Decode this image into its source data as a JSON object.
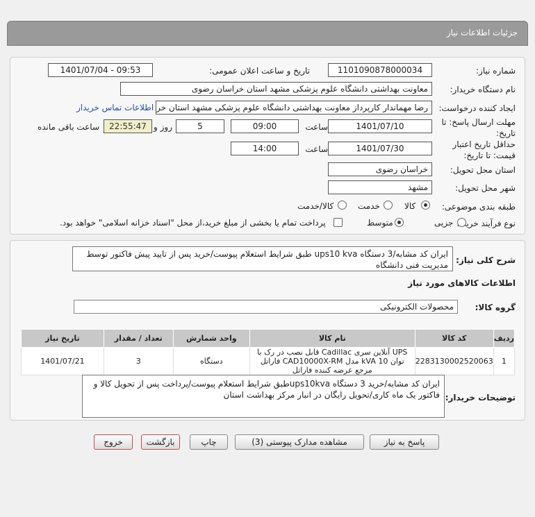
{
  "header": {
    "title": "جزئیات اطلاعات نیاز"
  },
  "form": {
    "need_number_label": "شماره نیاز:",
    "need_number": "1101090878000034",
    "announce_label": "تاریخ و ساعت اعلان عمومی:",
    "announce_value": "1401/07/04 - 09:53",
    "buyer_label": "نام دستگاه خریدار:",
    "buyer_value": "معاونت بهداشتی دانشگاه علوم پزشکی مشهد استان خراسان رضوی",
    "requester_label": "ایجاد کننده درخواست:",
    "requester_value": "رضا مهماندار کارپرداز معاونت بهداشتی دانشگاه علوم پزشکی مشهد استان خر",
    "contact_link": "اطلاعات تماس خریدار",
    "deadline_label": "مهلت ارسال پاسخ: تا تاریخ:",
    "deadline_date": "1401/07/10",
    "time_label": "ساعت",
    "deadline_time": "09:00",
    "days_value": "5",
    "days_label": "روز و",
    "remaining_value": "22:55:47",
    "remaining_label": "ساعت باقی مانده",
    "validity_label": "حداقل تاریخ اعتبار قیمت: تا تاریخ:",
    "validity_date": "1401/07/30",
    "validity_time_label": "ساعت",
    "validity_time": "14:00",
    "province_label": "استان محل تحویل:",
    "province_value": "خراسان رضوی",
    "city_label": "شهر محل تحویل:",
    "city_value": "مشهد",
    "category_label": "طبقه بندی موضوعی:",
    "category_options": [
      "کالا",
      "خدمت",
      "کالا/خدمت"
    ],
    "process_label": "نوع فرآیند خرید :",
    "process_options": [
      "جزیی",
      "متوسط"
    ],
    "payment_note": "پرداخت تمام یا بخشی از مبلغ خرید،از محل \"اسناد خزانه اسلامی\" خواهد بود."
  },
  "summary": {
    "label": "شرح کلی نیاز:",
    "text": "ایران کد مشابه/3 دستگاه ups10 kva طبق شرایط استعلام پیوست/خرید پس از تایید پیش فاکتور توسط مدیریت فنی دانشگاه"
  },
  "goods_section": {
    "title": "اطلاعات کالاهای مورد نیاز",
    "group_label": "گروه کالا:",
    "group_value": "محصولات الکترونیکی"
  },
  "table": {
    "headers": [
      "ردیف",
      "کد کالا",
      "نام کالا",
      "واحد شمارش",
      "تعداد / مقدار",
      "تاریخ نیاز"
    ],
    "rows": [
      {
        "row": "1",
        "code": "2283130002520063",
        "name": "UPS آنلاین سری Cadillac قابل نصب در رک با توان 10 kVA مدل CAD10000X-RM فاراتل مرجع عرضه کننده فاراتل",
        "unit": "دستگاه",
        "qty": "3",
        "date": "1401/07/21"
      }
    ]
  },
  "buyer_notes": {
    "label": "توضیحات خریدار:",
    "text": "ایران کد مشابه/خرید 3 دستگاه ups10kvaطبق شرایط استعلام پیوست/پرداخت پس از تحویل کالا و فاکتور یک ماه کاری/تحویل رایگان در انبار مرکز بهداشت استان"
  },
  "buttons": {
    "reply": "پاسخ به نیاز",
    "attachments": "مشاهده مدارک پیوستی (3)",
    "print": "چاپ",
    "back": "بازگشت",
    "exit": "خروج"
  },
  "colors": {
    "header_bg": "#9a9a9a",
    "link": "#1a4fb0",
    "exit_border": "#c84a4a"
  }
}
